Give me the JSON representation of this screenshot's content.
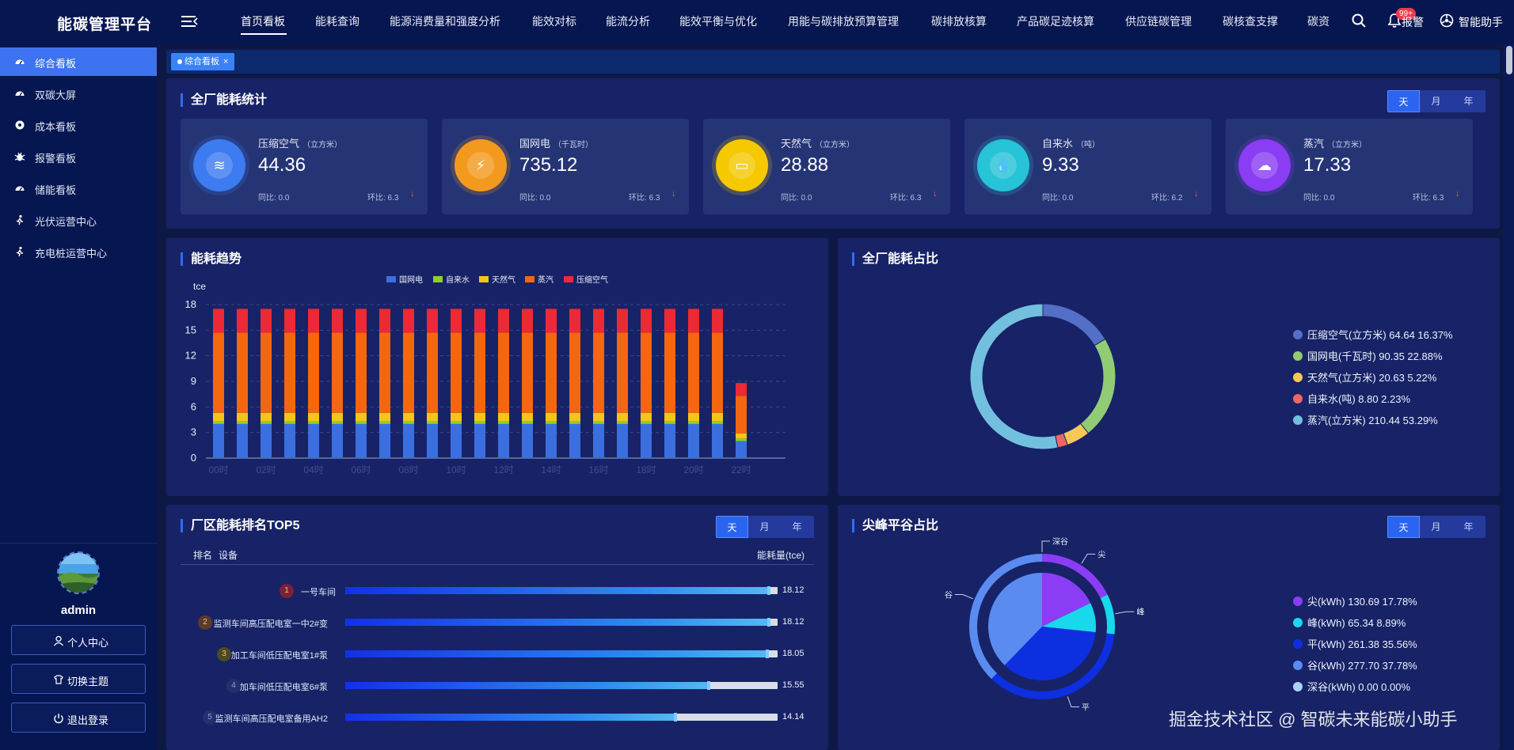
{
  "app": {
    "title": "能碳管理平台"
  },
  "nav": {
    "items": [
      "首页看板",
      "能耗查询",
      "能源消费量和强度分析",
      "能效对标",
      "能流分析",
      "能效平衡与优化",
      "用能与碳排放预算管理",
      "碳排放核算",
      "产品碳足迹核算",
      "供应链碳管理",
      "碳核查支撑",
      "碳资"
    ],
    "active": "首页看板",
    "badge": "99+",
    "alarm_label": "报警",
    "assistant_label": "智能助手"
  },
  "sidebar": {
    "items": [
      {
        "label": "综合看板",
        "icon": "dashboard-icon",
        "active": true
      },
      {
        "label": "双碳大屏",
        "icon": "dashboard-icon"
      },
      {
        "label": "成本看板",
        "icon": "settings-icon"
      },
      {
        "label": "报警看板",
        "icon": "bug-icon"
      },
      {
        "label": "储能看板",
        "icon": "dashboard-icon"
      },
      {
        "label": "光伏运营中心",
        "icon": "person-walk-icon"
      },
      {
        "label": "充电桩运营中心",
        "icon": "person-walk-icon"
      }
    ],
    "user": {
      "name": "admin"
    },
    "buttons": [
      {
        "label": "个人中心",
        "icon": "user-icon"
      },
      {
        "label": "切换主题",
        "icon": "theme-icon"
      },
      {
        "label": "退出登录",
        "icon": "power-icon"
      }
    ]
  },
  "tags": [
    {
      "label": "综合看板",
      "close": "×"
    }
  ],
  "segment": {
    "day": "天",
    "month": "月",
    "year": "年"
  },
  "energy_stats": {
    "title": "全厂能耗统计",
    "cards": [
      {
        "name": "压缩空气",
        "unit": "（立方米）",
        "value": "44.36",
        "yoy": "同比: 0.0",
        "mom": "环比: 6.3",
        "trend": "↓",
        "color": "#3c7bf0",
        "icon": "air-icon"
      },
      {
        "name": "国网电",
        "unit": "（千瓦时）",
        "value": "735.12",
        "yoy": "同比: 0.0",
        "mom": "环比: 6.3",
        "trend": "↓",
        "color": "#f39a1e",
        "icon": "power-tower-icon"
      },
      {
        "name": "天然气",
        "unit": "（立方米）",
        "value": "28.88",
        "yoy": "同比: 0.0",
        "mom": "环比: 6.3",
        "trend": "↓",
        "color": "#f5c800",
        "icon": "gas-icon"
      },
      {
        "name": "自来水",
        "unit": "（吨）",
        "value": "9.33",
        "yoy": "同比: 0.0",
        "mom": "环比: 6.2",
        "trend": "↓",
        "color": "#27c3d6",
        "icon": "water-tap-icon"
      },
      {
        "name": "蒸汽",
        "unit": "（立方米）",
        "value": "17.33",
        "yoy": "同比: 0.0",
        "mom": "环比: 6.3",
        "trend": "↓",
        "color": "#8a3df2",
        "icon": "steam-icon"
      }
    ]
  },
  "trend": {
    "title": "能耗趋势"
  },
  "share": {
    "title": "全厂能耗占比"
  },
  "ranking": {
    "title": "厂区能耗排名TOP5",
    "head_rank": "排名",
    "head_device": "设备",
    "head_value": "能耗量(tce)",
    "max": 18.5,
    "rows": [
      {
        "rank": "1",
        "name": "一号车间",
        "value": 18.12,
        "value_label": "18.12",
        "badge_color": "#7a2336"
      },
      {
        "rank": "2",
        "name": "监测车间高压配电室一中2#变",
        "value": 18.12,
        "value_label": "18.12",
        "badge_color": "#5c3a2a"
      },
      {
        "rank": "3",
        "name": "加工车间低压配电室1#泵",
        "value": 18.05,
        "value_label": "18.05",
        "badge_color": "#4d4a1f"
      },
      {
        "rank": "4",
        "name": "加车间低压配电室6#泵",
        "value": 15.55,
        "value_label": "15.55",
        "badge_color": "#22306e"
      },
      {
        "rank": "5",
        "name": "监测车间高压配电室备用AH2",
        "value": 14.14,
        "value_label": "14.14",
        "badge_color": "#22306e"
      }
    ]
  },
  "peak": {
    "title": "尖峰平谷占比"
  },
  "chart_data": [
    {
      "type": "bar",
      "stacked": true,
      "ylabel": "tce",
      "ylim": [
        0,
        18
      ],
      "yticks": [
        "0",
        "3",
        "6",
        "9",
        "12",
        "15",
        "18"
      ],
      "categories": [
        "00时",
        "01时",
        "02时",
        "03时",
        "04时",
        "05时",
        "06时",
        "07时",
        "08时",
        "09时",
        "10时",
        "11时",
        "12时",
        "13时",
        "14时",
        "15时",
        "16时",
        "17时",
        "18时",
        "19时",
        "20时",
        "21时",
        "22时"
      ],
      "xtick_labels": [
        "00时",
        "02时",
        "04时",
        "06时",
        "08时",
        "10时",
        "12时",
        "14时",
        "16时",
        "18时",
        "20时",
        "22时"
      ],
      "legend_position": "top",
      "series": [
        {
          "name": "国网电",
          "color": "#3b6fe0",
          "values": [
            4.0,
            4.0,
            4.0,
            4.0,
            4.0,
            4.0,
            4.0,
            4.0,
            4.0,
            4.0,
            4.0,
            4.0,
            4.0,
            4.0,
            4.0,
            4.0,
            4.0,
            4.0,
            4.0,
            4.0,
            4.0,
            4.0,
            2.0
          ]
        },
        {
          "name": "自来水",
          "color": "#8ed21f",
          "values": [
            0.3,
            0.3,
            0.3,
            0.3,
            0.3,
            0.3,
            0.3,
            0.3,
            0.3,
            0.3,
            0.3,
            0.3,
            0.3,
            0.3,
            0.3,
            0.3,
            0.3,
            0.3,
            0.3,
            0.3,
            0.3,
            0.3,
            0.3
          ]
        },
        {
          "name": "天然气",
          "color": "#f5c518",
          "values": [
            1.0,
            1.0,
            1.0,
            1.0,
            1.0,
            1.0,
            1.0,
            1.0,
            1.0,
            1.0,
            1.0,
            1.0,
            1.0,
            1.0,
            1.0,
            1.0,
            1.0,
            1.0,
            1.0,
            1.0,
            1.0,
            1.0,
            0.6
          ]
        },
        {
          "name": "蒸汽",
          "color": "#f5670f",
          "values": [
            9.4,
            9.4,
            9.4,
            9.4,
            9.4,
            9.4,
            9.4,
            9.4,
            9.4,
            9.4,
            9.4,
            9.4,
            9.4,
            9.4,
            9.4,
            9.4,
            9.4,
            9.4,
            9.4,
            9.4,
            9.4,
            9.4,
            4.4
          ]
        },
        {
          "name": "压缩空气",
          "color": "#ec2a35",
          "values": [
            2.8,
            2.8,
            2.8,
            2.8,
            2.8,
            2.8,
            2.8,
            2.8,
            2.8,
            2.8,
            2.8,
            2.8,
            2.8,
            2.8,
            2.8,
            2.8,
            2.8,
            2.8,
            2.8,
            2.8,
            2.8,
            2.8,
            1.5
          ]
        }
      ]
    },
    {
      "type": "pie",
      "donut": true,
      "legend_position": "right",
      "slices": [
        {
          "label": "压缩空气(立方米)",
          "value": 64.64,
          "percent": "16.37%",
          "color": "#5470c6",
          "text": "压缩空气(立方米)   64.64  16.37%"
        },
        {
          "label": "国网电(千瓦时)",
          "value": 90.35,
          "percent": "22.88%",
          "color": "#91cc75",
          "text": "国网电(千瓦时)    90.35  22.88%"
        },
        {
          "label": "天然气(立方米)",
          "value": 20.63,
          "percent": "5.22%",
          "color": "#fac858",
          "text": "天然气(立方米)    20.63  5.22%"
        },
        {
          "label": "自来水(吨)",
          "value": 8.8,
          "percent": "2.23%",
          "color": "#ee6666",
          "text": "自来水(吨)    8.80  2.23%"
        },
        {
          "label": "蒸汽(立方米)",
          "value": 210.44,
          "percent": "53.29%",
          "color": "#73c0de",
          "text": "蒸汽(立方米)    210.44  53.29%"
        }
      ]
    },
    {
      "type": "pie",
      "nested": true,
      "legend_position": "right",
      "slices": [
        {
          "label": "尖",
          "unit_label": "尖(kWh)",
          "value": 130.69,
          "percent": "17.78%",
          "color": "#8b3cf5",
          "text": "尖(kWh)    130.69  17.78%"
        },
        {
          "label": "峰",
          "unit_label": "峰(kWh)",
          "value": 65.34,
          "percent": "8.89%",
          "color": "#1ad8ec",
          "text": "峰(kWh)    65.34  8.89%"
        },
        {
          "label": "平",
          "unit_label": "平(kWh)",
          "value": 261.38,
          "percent": "35.56%",
          "color": "#0d2fe0",
          "text": "平(kWh)    261.38  35.56%"
        },
        {
          "label": "谷",
          "unit_label": "谷(kWh)",
          "value": 277.7,
          "percent": "37.78%",
          "color": "#5a8bf0",
          "text": "谷(kWh)    277.70  37.78%"
        },
        {
          "label": "深谷",
          "unit_label": "深谷(kWh)",
          "value": 0.0,
          "percent": "0.00%",
          "color": "#a9d3f5",
          "text": "深谷(kWh)    0.00  0.00%"
        }
      ]
    }
  ],
  "watermark": "掘金技术社区 @ 智碳未来能碳小助手"
}
